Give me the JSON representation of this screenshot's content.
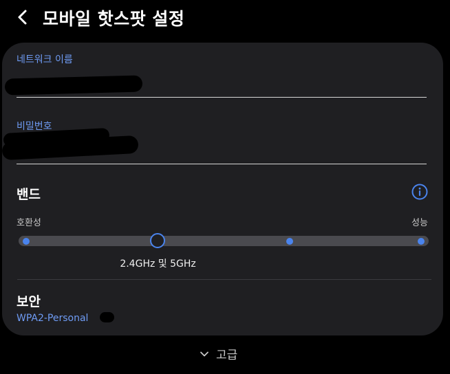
{
  "header": {
    "title": "모바일 핫스팟 설정"
  },
  "network": {
    "name_label": "네트워크 이름",
    "password_label": "비밀번호"
  },
  "band": {
    "title": "밴드",
    "left_label": "호환성",
    "right_label": "성능",
    "selected_value": "2.4GHz 및 5GHz",
    "selected_index": 1,
    "stop_count": 4
  },
  "security": {
    "title": "보안",
    "value": "WPA2-Personal"
  },
  "advanced": {
    "label": "고급"
  },
  "colors": {
    "background": "#000000",
    "card": "#1f1f22",
    "accent": "#4a84ee",
    "label_blue": "#6f9cf5"
  },
  "icons": {
    "back": "chevron-left-icon",
    "info": "info-icon",
    "advanced": "chevron-down-icon"
  }
}
